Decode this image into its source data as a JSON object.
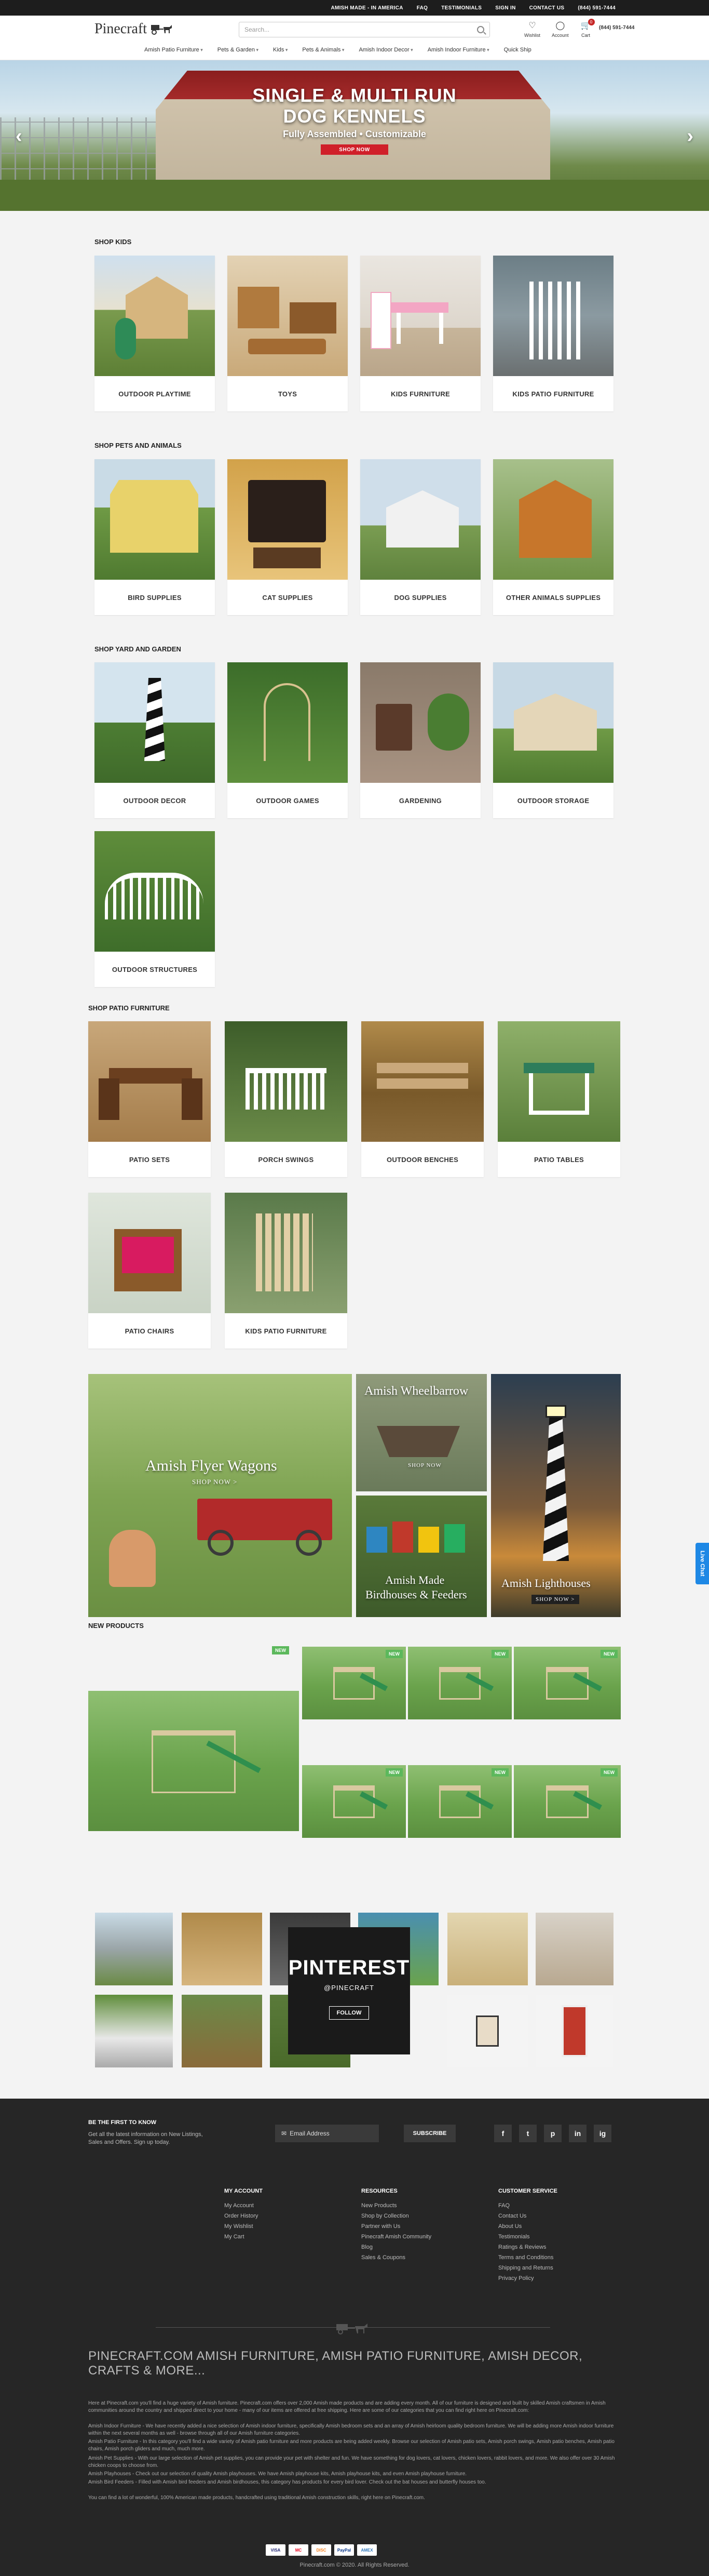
{
  "topbar": {
    "links": [
      "Amish Made - In America",
      "FAQ",
      "Testimonials",
      "Sign In",
      "Contact Us",
      "(844) 591-7444"
    ]
  },
  "header": {
    "logo_text": "Pinecraft",
    "search_placeholder": "Search...",
    "icons": {
      "wishlist": "Wishlist",
      "account": "Account",
      "cart": "Cart",
      "cart_count": "0"
    },
    "nav": [
      "Amish Patio Furniture",
      "Pets & Garden",
      "Kids",
      "Pets & Animals",
      "Amish Indoor Decor",
      "Amish Indoor Furniture",
      "Quick Ship"
    ]
  },
  "hero": {
    "title_line1": "SINGLE & MULTI RUN",
    "title_line2": "DOG KENNELS",
    "subtitle": "Fully Assembled • Customizable",
    "button": "SHOP NOW",
    "prev": "‹",
    "next": "›"
  },
  "sections": {
    "kids": {
      "title": "SHOP KIDS",
      "items": [
        "OUTDOOR PLAYTIME",
        "TOYS",
        "KIDS FURNITURE",
        "KIDS PATIO FURNITURE"
      ]
    },
    "pets": {
      "title": "SHOP PETS AND ANIMALS",
      "items": [
        "BIRD SUPPLIES",
        "CAT SUPPLIES",
        "DOG SUPPLIES",
        "OTHER ANIMALS SUPPLIES"
      ]
    },
    "yard": {
      "title": "SHOP YARD AND GARDEN",
      "items": [
        "OUTDOOR DECOR",
        "OUTDOOR GAMES",
        "GARDENING",
        "OUTDOOR STORAGE",
        "OUTDOOR STRUCTURES"
      ]
    },
    "patio": {
      "title": "SHOP PATIO FURNITURE",
      "items": [
        "PATIO SETS",
        "PORCH SWINGS",
        "OUTDOOR BENCHES",
        "PATIO TABLES",
        "PATIO CHAIRS",
        "KIDS PATIO FURNITURE"
      ]
    }
  },
  "promos": {
    "wagons": {
      "title": "Amish Flyer Wagons",
      "cta": "SHOP NOW >"
    },
    "wheelbarrow": {
      "title": "Amish Wheelbarrow",
      "cta": "SHOP NOW"
    },
    "birdhouses": {
      "title_line1": "Amish Made",
      "title_line2": "Birdhouses & Feeders"
    },
    "lighthouses": {
      "title": "Amish Lighthouses",
      "cta": "SHOP NOW >"
    }
  },
  "new_products": {
    "title": "NEW PRODUCTS",
    "tag": "NEW"
  },
  "pinterest": {
    "title": "PINTEREST",
    "handle": "@PINECRAFT",
    "follow": "FOLLOW"
  },
  "livechat": "Live Chat",
  "footer": {
    "newsletter_title": "BE THE FIRST TO KNOW",
    "newsletter_text": "Get all the latest information on New Listings, Sales and Offers. Sign up today.",
    "email_placeholder": "Email Address",
    "subscribe": "SUBSCRIBE",
    "social": [
      "f",
      "t",
      "p",
      "in",
      "ig"
    ],
    "columns": [
      {
        "title": "MY ACCOUNT",
        "items": [
          "My Account",
          "Order History",
          "My Wishlist",
          "My Cart"
        ]
      },
      {
        "title": "RESOURCES",
        "items": [
          "New Products",
          "Shop by Collection",
          "Partner with Us",
          "Pinecraft Amish Community",
          "Blog",
          "Sales & Coupons"
        ]
      },
      {
        "title": "CUSTOMER SERVICE",
        "items": [
          "FAQ",
          "Contact Us",
          "About Us",
          "Testimonials",
          "Ratings & Reviews",
          "Terms and Conditions",
          "Shipping and Returns",
          "Privacy Policy"
        ]
      }
    ],
    "seo_title": "PINECRAFT.COM AMISH FURNITURE, AMISH PATIO FURNITURE, AMISH DECOR, CRAFTS & MORE...",
    "seo_paragraphs": [
      "Here at Pinecraft.com you'll find a huge variety of Amish furniture. Pinecraft.com offers over 2,000 Amish made products and are adding every month. All of our furniture is designed and built by skilled Amish craftsmen in Amish communities around the country and shipped direct to your home - many of our items are offered at free shipping. Here are some of our categories that you can find right here on Pinecraft.com:",
      "Amish Indoor Furniture - We have recently added a nice selection of Amish indoor furniture, specifically Amish bedroom sets and an array of Amish heirloom quality bedroom furniture. We will be adding more Amish indoor furniture within the next several months as well - browse through all of our Amish furniture categories.",
      "Amish Patio Furniture - In this category you'll find a wide variety of Amish patio furniture and more products are being added weekly. Browse our selection of Amish patio sets, Amish porch swings, Amish patio benches, Amish patio chairs, Amish porch gliders and much, much more.",
      "Amish Pet Supplies - With our large selection of Amish pet supplies, you can provide your pet with shelter and fun. We have something for dog lovers, cat lovers, chicken lovers, rabbit lovers, and more. We also offer over 30 Amish chicken coops to choose from.",
      "Amish Playhouses - Check out our selection of quality Amish playhouses. We have Amish playhouse kits, Amish playhouse kits, and even Amish playhouse furniture.",
      "Amish Bird Feeders - Filled with Amish bird feeders and Amish birdhouses, this category has products for every bird lover. Check out the bat houses and butterfly houses too.",
      "You can find a lot of wonderful, 100% American made products, handcrafted using traditional Amish construction skills, right here on Pinecraft.com."
    ],
    "payments": [
      "VISA",
      "MC",
      "DISC",
      "PayPal",
      "AMEX"
    ],
    "copyright": "Pinecraft.com © 2020. All Rights Reserved."
  },
  "colors": {
    "accent_red": "#d0202a",
    "new_badge": "#5cb85c",
    "footer_bg": "#262626",
    "topbar_bg": "#1d1d1d",
    "livechat": "#1e88e5"
  }
}
